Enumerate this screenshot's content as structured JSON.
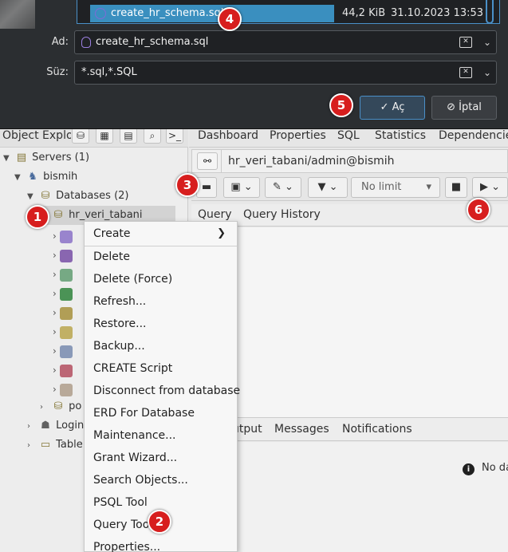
{
  "dialog": {
    "selected_file": {
      "name": "create_hr_schema.sql",
      "size": "44,2 KiB",
      "date": "31.10.2023 13:53"
    },
    "name_label": "Ad:",
    "name_value": "create_hr_schema.sql",
    "filter_label": "Süz:",
    "filter_value": "*.sql,*.SQL",
    "open_button": "Aç",
    "cancel_button": "İptal"
  },
  "object_explorer": {
    "title": "Object Explorer",
    "tree": {
      "servers": "Servers (1)",
      "server": "bismih",
      "databases": "Databases (2)",
      "database": "hr_veri_tabani",
      "other_db": "po",
      "login": "Login",
      "tablespaces": "Table"
    }
  },
  "right_panel": {
    "tabs": [
      "Dashboard",
      "Properties",
      "SQL",
      "Statistics",
      "Dependencies"
    ],
    "connection": "hr_veri_tabani/admin@bismih",
    "limit": "No limit",
    "editor_tabs": [
      "Query",
      "Query History"
    ],
    "output_tabs": [
      "Output",
      "Messages",
      "Notifications"
    ],
    "no_data": "No da"
  },
  "context_menu": {
    "items": [
      "Create",
      "Delete",
      "Delete (Force)",
      "Refresh...",
      "Restore...",
      "Backup...",
      "CREATE Script",
      "Disconnect from database",
      "ERD For Database",
      "Maintenance...",
      "Grant Wizard...",
      "Search Objects...",
      "PSQL Tool",
      "Query Tool",
      "Properties..."
    ]
  },
  "markers": [
    "1",
    "2",
    "3",
    "4",
    "5",
    "6"
  ],
  "colors": {
    "dialog_bg": "#2b2e31",
    "selection": "#3a8fbf",
    "marker": "#d71e1e"
  }
}
